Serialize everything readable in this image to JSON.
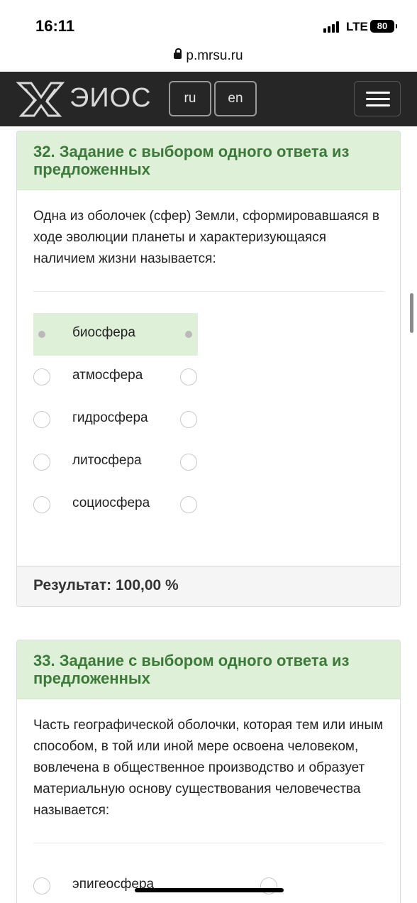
{
  "status_bar": {
    "time": "16:11",
    "network": "LTE",
    "battery": "80"
  },
  "browser": {
    "url": "p.mrsu.ru"
  },
  "header": {
    "logo_text": "ЭИОС",
    "lang_ru": "ru",
    "lang_en": "en"
  },
  "questions": [
    {
      "title": "32. Задание с выбором одного ответа из предложенных",
      "text": "Одна из оболочек (сфер) Земли, сформировавшаяся в ходе эволюции планеты и характеризующаяся наличием жизни называется:",
      "options": [
        "биосфера",
        "атмосфера",
        "гидросфера",
        "литосфера",
        "социосфера"
      ],
      "selected": "биосфера",
      "result_label": "Результат:",
      "result_value": "100,00 %"
    },
    {
      "title": "33. Задание с выбором одного ответа из предложенных",
      "text": "Часть географической оболочки, которая тем или иным способом, в той или иной мере освоена человеком, вовлечена в общественное производство и образует материальную основу существования человечества называется:",
      "options": [
        "эпигеосфера"
      ]
    }
  ]
}
